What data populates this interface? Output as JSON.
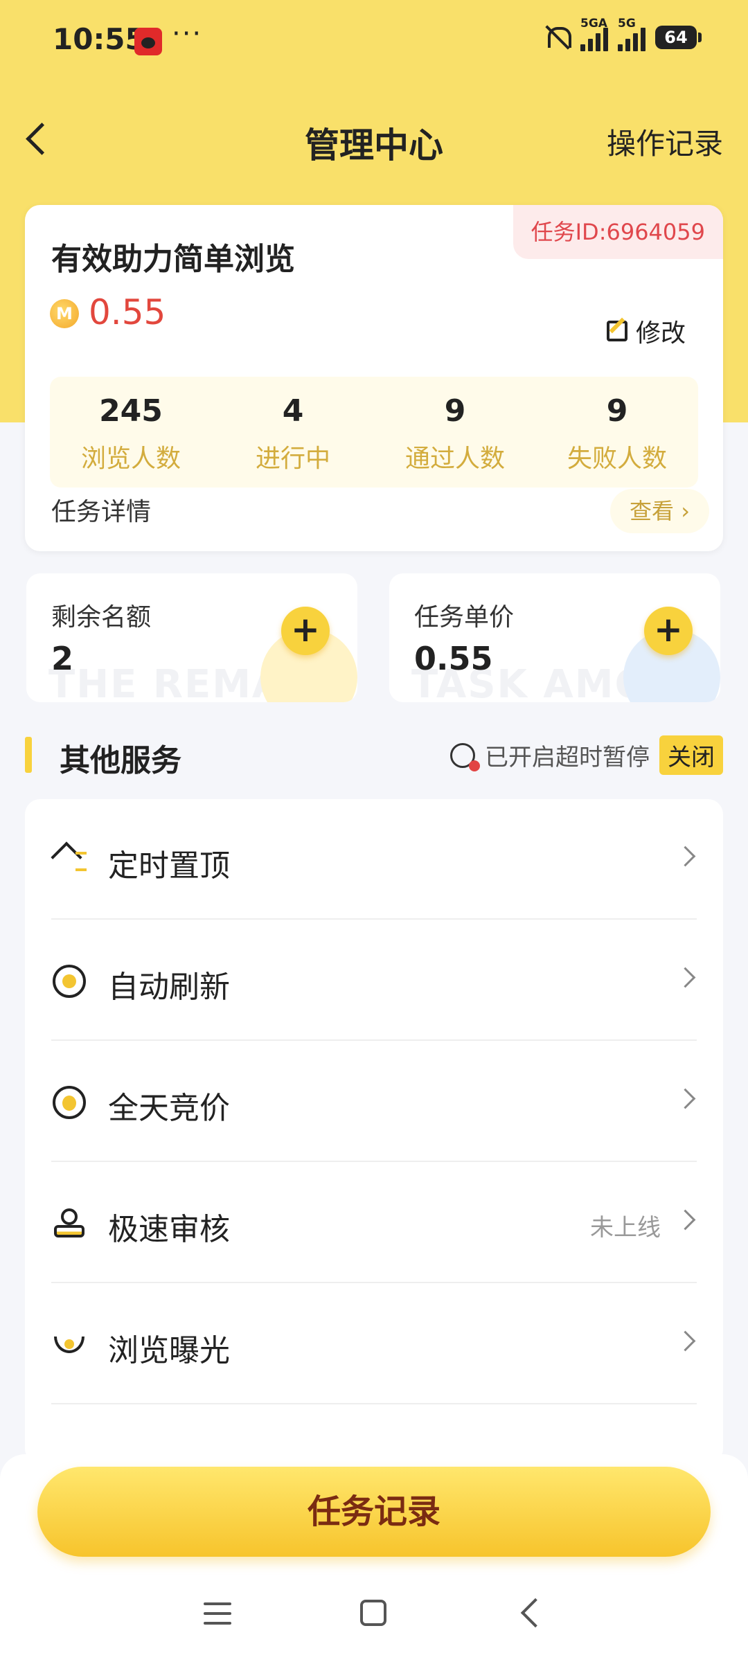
{
  "status_bar": {
    "time": "10:55",
    "dots": "···",
    "signal1_label": "5GA",
    "signal2_label": "5G",
    "battery": "64"
  },
  "header": {
    "title": "管理中心",
    "right_action": "操作记录"
  },
  "task_card": {
    "task_id": "任务ID:6964059",
    "title": "有效助力简单浏览",
    "coin_symbol": "M",
    "price": "0.55",
    "edit_label": "修改",
    "stats": [
      {
        "value": "245",
        "label": "浏览人数"
      },
      {
        "value": "4",
        "label": "进行中"
      },
      {
        "value": "9",
        "label": "通过人数"
      },
      {
        "value": "9",
        "label": "失败人数"
      }
    ],
    "detail_label": "任务详情",
    "view_label": "查看 ›"
  },
  "quota_cards": [
    {
      "label": "剩余名额",
      "value": "2",
      "watermark": "THE REMAIN",
      "plus": "+"
    },
    {
      "label": "任务单价",
      "value": "0.55",
      "watermark": "TASK AMOU",
      "plus": "+"
    }
  ],
  "services": {
    "title": "其他服务",
    "timeout_text": "已开启超时暂停",
    "close_label": "关闭",
    "items": [
      {
        "name": "定时置顶",
        "status": "",
        "icon": "pin-top-icon"
      },
      {
        "name": "自动刷新",
        "status": "",
        "icon": "refresh-icon"
      },
      {
        "name": "全天竞价",
        "status": "",
        "icon": "flame-icon"
      },
      {
        "name": "极速审核",
        "status": "未上线",
        "icon": "stamp-icon"
      },
      {
        "name": "浏览曝光",
        "status": "",
        "icon": "eye-icon"
      }
    ]
  },
  "bottom": {
    "task_log_label": "任务记录"
  },
  "colors": {
    "brand_yellow": "#F9E06A",
    "button_yellow": "#F8D23D",
    "price_red": "#E2473D",
    "stat_label": "#D3AC3D"
  }
}
